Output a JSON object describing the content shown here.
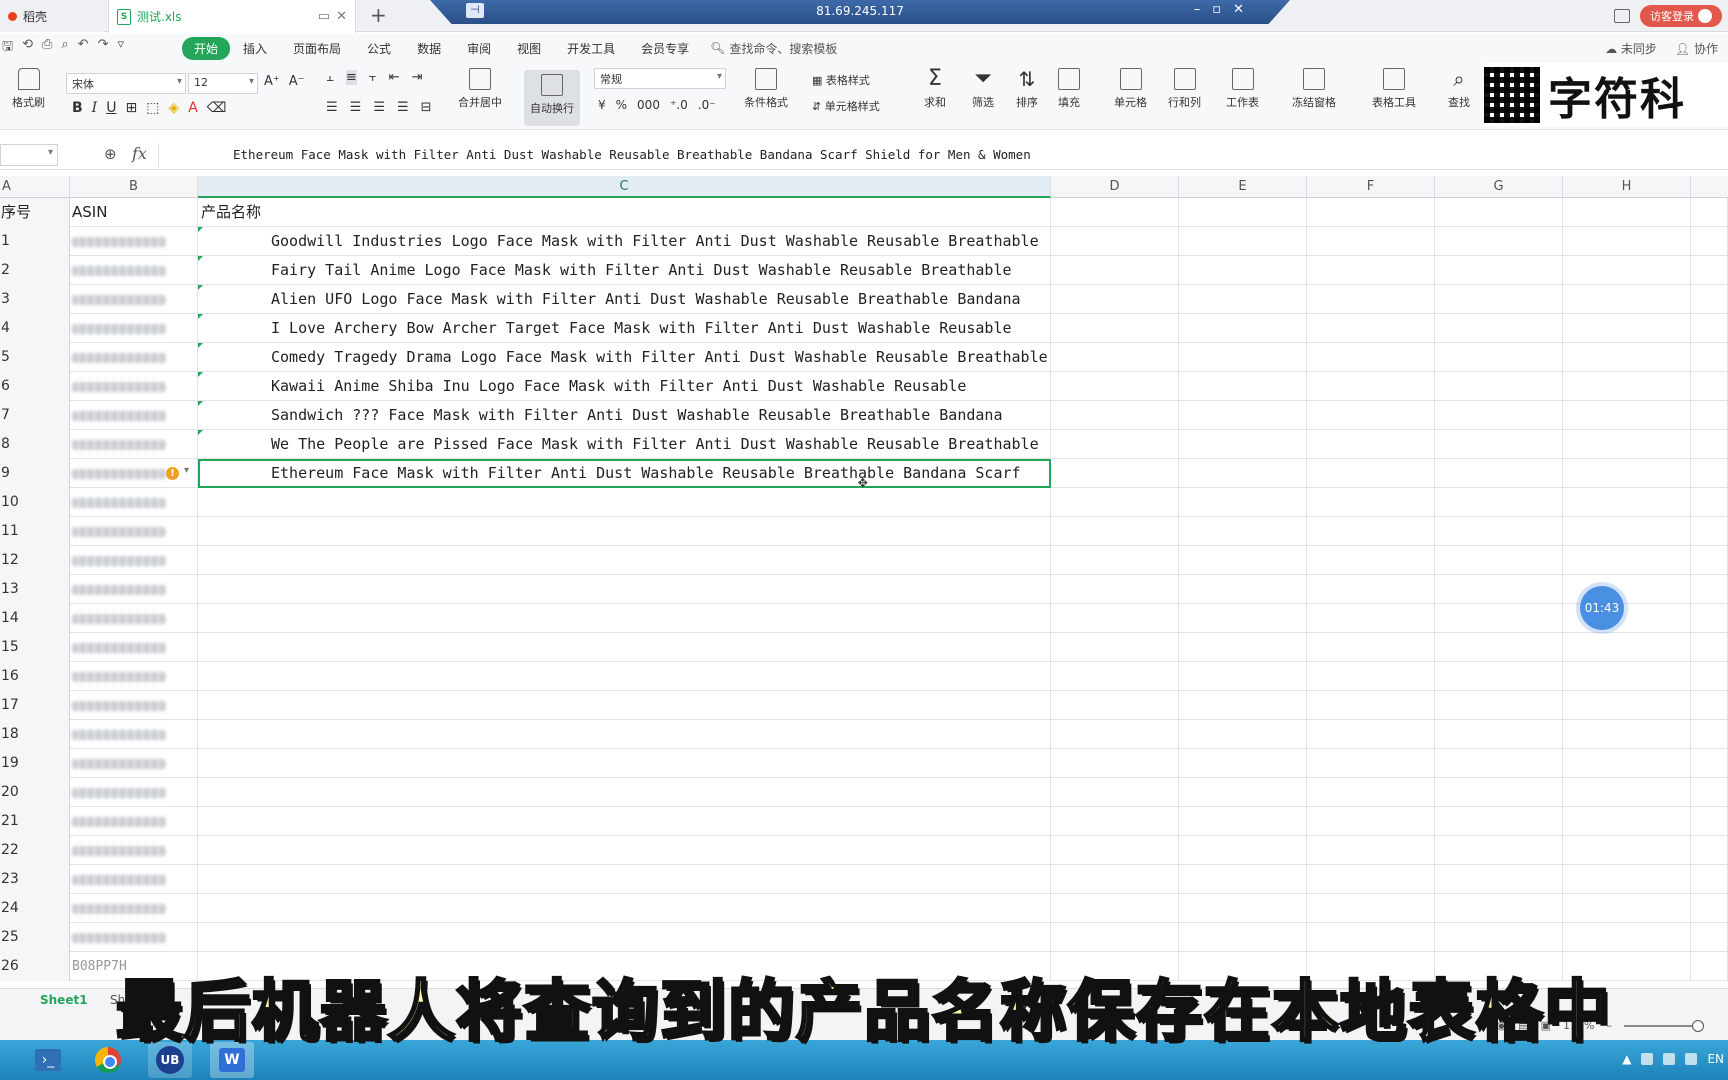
{
  "tabs": {
    "home_label": "稻壳",
    "doc_label": "测试.xls",
    "doc_type": "S"
  },
  "remote": {
    "ip": "81.69.245.117"
  },
  "title_right": {
    "login": "访客登录"
  },
  "menu": {
    "items": [
      "开始",
      "插入",
      "页面布局",
      "公式",
      "数据",
      "审阅",
      "视图",
      "开发工具",
      "会员专享"
    ],
    "active": "开始",
    "search": "查找命令、搜索模板",
    "sync": "未同步",
    "collab": "协作"
  },
  "ribbon": {
    "format_painter": "格式刷",
    "font_name": "宋体",
    "font_size": "12",
    "merge_center": "合并居中",
    "auto_wrap": "自动换行",
    "number_format": "常规",
    "conditional_format": "条件格式",
    "table_style": "表格样式",
    "cell_style": "单元格样式",
    "sum": "求和",
    "filter": "筛选",
    "sort": "排序",
    "fill": "填充",
    "cells": "单元格",
    "rows_cols": "行和列",
    "worksheet": "工作表",
    "freeze": "冻结窗格",
    "table_tools": "表格工具",
    "find": "查找",
    "brand": "字符科"
  },
  "formula": {
    "fx": "fx",
    "value": "Ethereum Face Mask with Filter Anti Dust Washable Reusable Breathable Bandana Scarf Shield for Men & Women"
  },
  "columns": [
    "A",
    "B",
    "C",
    "D",
    "E",
    "F",
    "G",
    "H"
  ],
  "header_row": {
    "a": "序号",
    "b": "ASIN",
    "c": "产品名称"
  },
  "rows": [
    {
      "n": "1",
      "c": "Goodwill Industries Logo Face Mask with Filter Anti Dust Washable Reusable Breathable"
    },
    {
      "n": "2",
      "c": "Fairy Tail Anime Logo Face Mask with Filter Anti Dust Washable Reusable Breathable"
    },
    {
      "n": "3",
      "c": "Alien UFO Logo Face Mask with Filter Anti Dust Washable Reusable Breathable Bandana"
    },
    {
      "n": "4",
      "c": "I Love Archery Bow Archer Target Face Mask with Filter Anti Dust Washable Reusable"
    },
    {
      "n": "5",
      "c": "Comedy Tragedy Drama Logo Face Mask with Filter Anti Dust Washable Reusable Breathable"
    },
    {
      "n": "6",
      "c": "Kawaii Anime Shiba Inu Logo Face Mask with Filter Anti Dust Washable Reusable"
    },
    {
      "n": "7",
      "c": "Sandwich ??? Face Mask with Filter Anti Dust Washable Reusable Breathable Bandana"
    },
    {
      "n": "8",
      "c": "We The People are Pissed Face Mask with Filter Anti Dust Washable Reusable Breathable"
    },
    {
      "n": "9",
      "c": "Ethereum Face Mask with Filter Anti Dust Washable Reusable Breathable Bandana Scarf"
    },
    {
      "n": "10",
      "c": ""
    },
    {
      "n": "11",
      "c": ""
    },
    {
      "n": "12",
      "c": ""
    },
    {
      "n": "13",
      "c": ""
    },
    {
      "n": "14",
      "c": ""
    },
    {
      "n": "15",
      "c": ""
    },
    {
      "n": "16",
      "c": ""
    },
    {
      "n": "17",
      "c": ""
    },
    {
      "n": "18",
      "c": ""
    },
    {
      "n": "19",
      "c": ""
    },
    {
      "n": "20",
      "c": ""
    },
    {
      "n": "21",
      "c": ""
    },
    {
      "n": "22",
      "c": ""
    },
    {
      "n": "23",
      "c": ""
    },
    {
      "n": "24",
      "c": ""
    },
    {
      "n": "25",
      "c": ""
    },
    {
      "n": "26",
      "c": "",
      "b": "B08PP7H"
    }
  ],
  "timer": "01:43",
  "sheets": {
    "sheet1": "Sheet1",
    "sheet2": "She"
  },
  "status": {
    "zoom": "115%"
  },
  "subtitle": "最后机器人将查询到的产品名称保存在本地表格中",
  "taskbar": {
    "ub_label": "UB",
    "tray_lang": "EN"
  },
  "colors": {
    "accent": "#23a55a",
    "remote_bar": "#2a4f86",
    "subtitle_fill": "#fff8a0"
  }
}
